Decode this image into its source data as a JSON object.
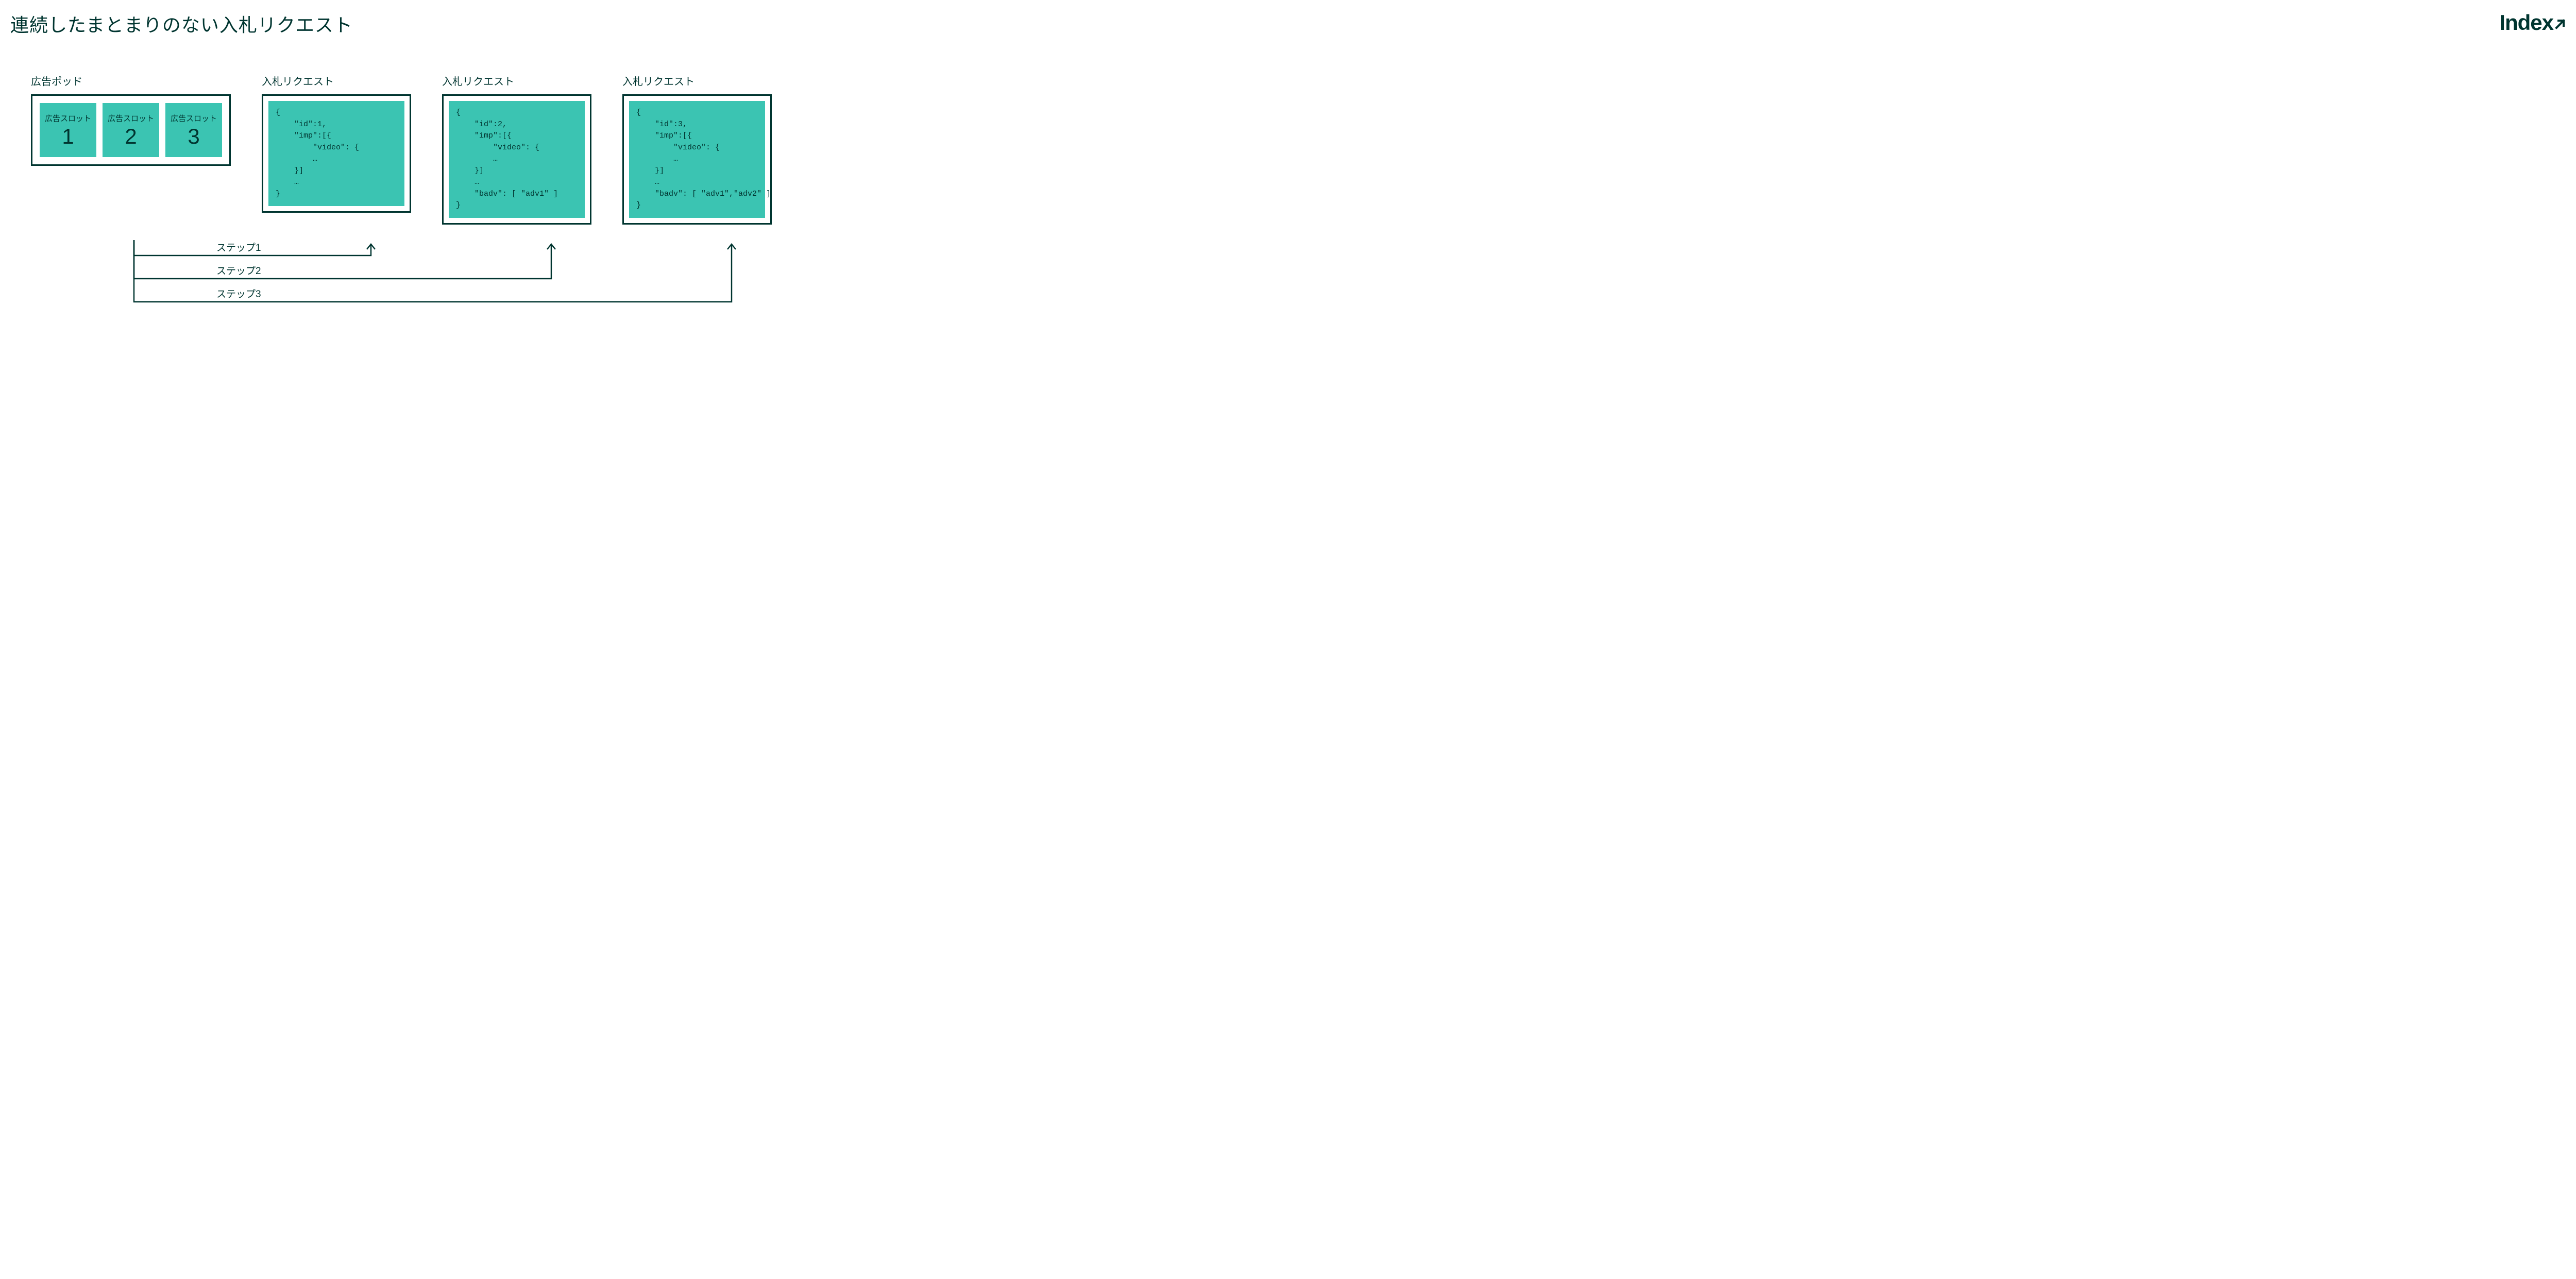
{
  "title": "連続したまとまりのない入札リクエスト",
  "logo_text": "Index",
  "adpod": {
    "label": "広告ポッド",
    "slot_label": "広告スロット",
    "slots": [
      "1",
      "2",
      "3"
    ]
  },
  "bid_requests": [
    {
      "label": "入札リクエスト",
      "code": "{\n    \"id\":1,\n    \"imp\":[{\n        \"video\": {\n        …\n    }]\n    …\n}"
    },
    {
      "label": "入札リクエスト",
      "code": "{\n    \"id\":2,\n    \"imp\":[{\n        \"video\": {\n        …\n    }]\n    …\n    \"badv\": [ \"adv1\" ]\n}"
    },
    {
      "label": "入札リクエスト",
      "code": "{\n    \"id\":3,\n    \"imp\":[{\n        \"video\": {\n        …\n    }]\n    …\n    \"badv\": [ \"adv1\",\"adv2\" ]\n}"
    }
  ],
  "steps": {
    "s1": "ステップ1",
    "s2": "ステップ2",
    "s3": "ステップ3"
  }
}
